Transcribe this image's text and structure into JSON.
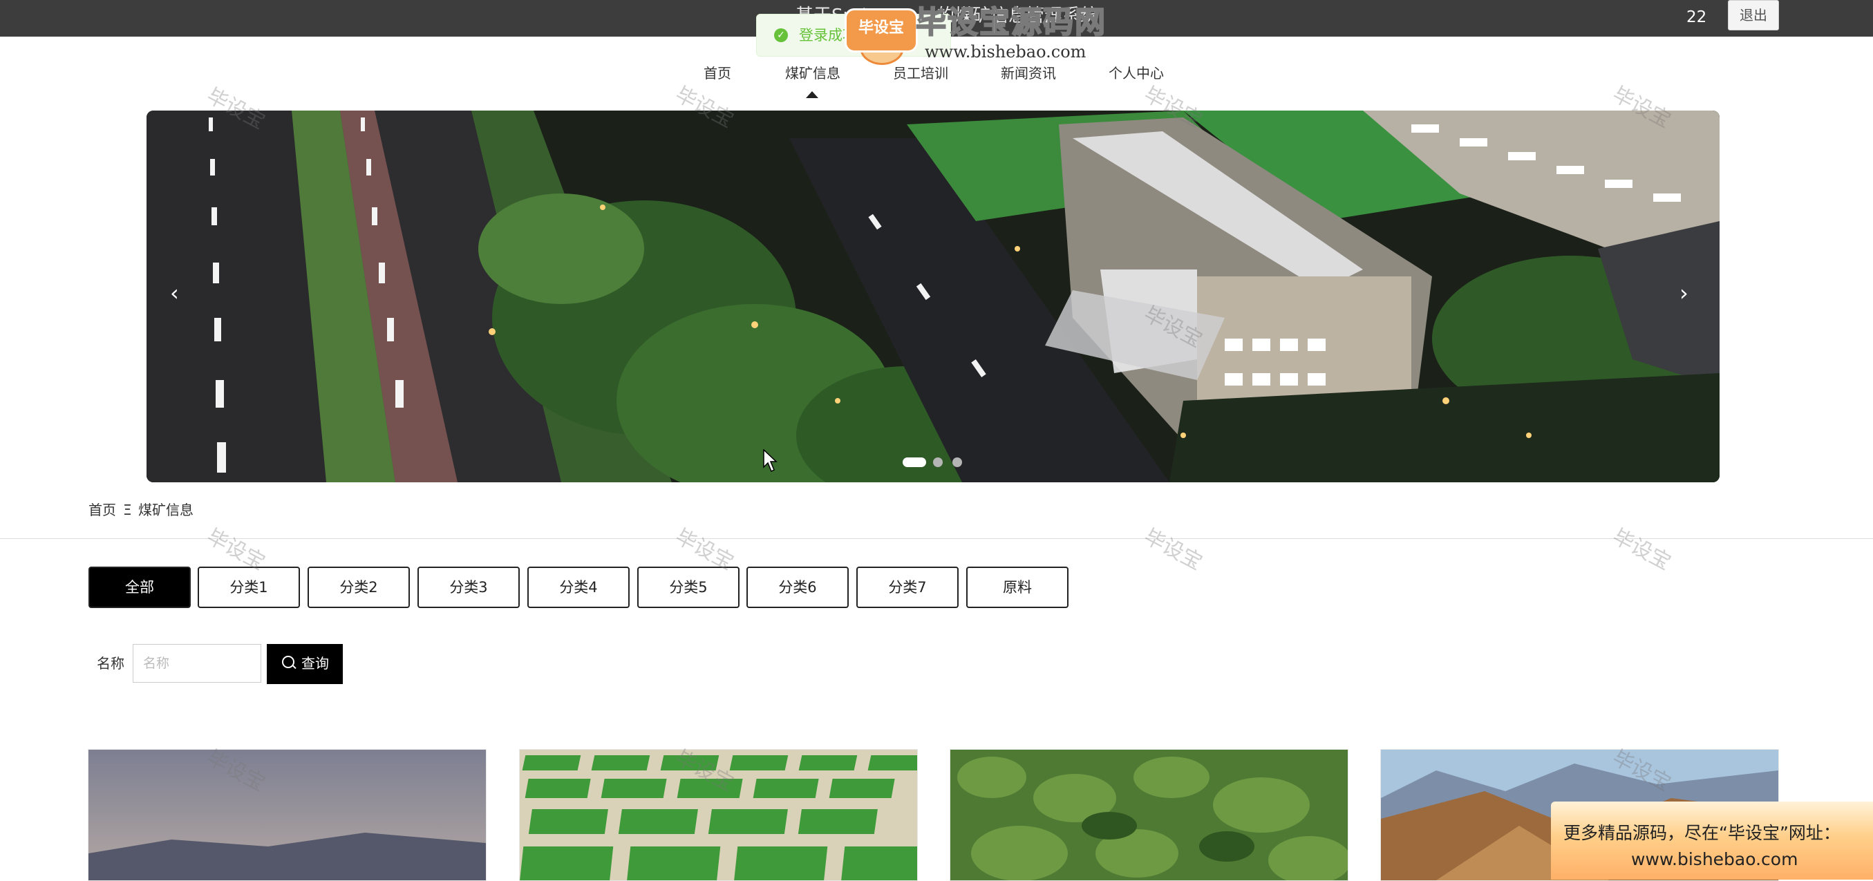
{
  "header": {
    "system_title": "基于Spring Boot的煤矿信息管理系统",
    "user_name": "22",
    "logout_label": "退出"
  },
  "toast": {
    "message": "登录成功"
  },
  "logo_watermark": {
    "badge": "毕设宝",
    "title": "毕设宝源码网",
    "url": "www.bishebao.com"
  },
  "nav": {
    "items": [
      {
        "label": "首页"
      },
      {
        "label": "煤矿信息"
      },
      {
        "label": "员工培训"
      },
      {
        "label": "新闻资讯"
      },
      {
        "label": "个人中心"
      }
    ],
    "active": "煤矿信息"
  },
  "carousel": {
    "prev_icon": "‹",
    "next_icon": "›",
    "slide_count": 3,
    "active_slide": 1
  },
  "breadcrumb": {
    "home": "首页",
    "separator": "Ξ",
    "current": "煤矿信息"
  },
  "categories": {
    "items": [
      "全部",
      "分类1",
      "分类2",
      "分类3",
      "分类4",
      "分类5",
      "分类6",
      "分类7",
      "原料"
    ],
    "active": "全部"
  },
  "search": {
    "name_label": "名称",
    "name_placeholder": "名称",
    "name_value": "",
    "button_label": "查询"
  },
  "watermark_text": "毕设宝",
  "promo": {
    "line1": "更多精品源码，尽在“毕设宝”网址：",
    "line2": "www.bishebao.com"
  },
  "colors": {
    "topbar": "#3d3d3d",
    "toast_success": "#67c23a",
    "active_category": "#000000",
    "promo_orange": "#ffb067"
  }
}
